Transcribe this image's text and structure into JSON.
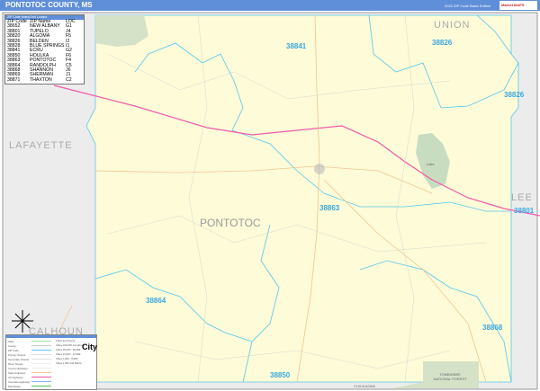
{
  "header": {
    "title": "PONTOTOC COUNTY, MS",
    "edition": "2022 ZIP Code Basic Edition",
    "logo_text": "Market MAPS"
  },
  "zip_table": {
    "title": "ZIP Code Index/Grid Locator",
    "columns": [
      "ZIP Code",
      "ZIP Name",
      "LOC"
    ],
    "rows": [
      [
        "38652",
        "NEW ALBANY",
        "G1"
      ],
      [
        "38801",
        "TUPELO",
        "J4"
      ],
      [
        "38820",
        "ALGOMA",
        "F5"
      ],
      [
        "38826",
        "BELDEN",
        "I2"
      ],
      [
        "38828",
        "BLUE SPRINGS",
        "I1"
      ],
      [
        "38841",
        "ECRU",
        "G2"
      ],
      [
        "38850",
        "HOULKA",
        "F6"
      ],
      [
        "38863",
        "PONTOTOC",
        "F4"
      ],
      [
        "38864",
        "RANDOLPH",
        "C5"
      ],
      [
        "38868",
        "SHANNON",
        "J6"
      ],
      [
        "38869",
        "SHERMAN",
        "J1"
      ],
      [
        "38871",
        "THAXTON",
        "C2"
      ]
    ]
  },
  "map": {
    "counties": {
      "union": "UNION",
      "lafayette": "LAFAYETTE",
      "lee": "LEE",
      "calhoun": "CALHOUN",
      "chickasaw": "CHICKASAW",
      "pontotoc": "PONTOTOC"
    },
    "zip_labels": {
      "z38841": "38841",
      "z38826a": "38826",
      "z38826b": "38826",
      "z38801": "38801",
      "z38863": "38863",
      "z38864": "38864",
      "z38850": "38850",
      "z38868": "38868"
    },
    "park_label": "TOMBIGBEE NATIONAL FOREST",
    "lake_label": "Lake"
  },
  "legend": {
    "title": "Legend",
    "items": [
      "State",
      "County",
      "ZIP Code",
      "Primary Streets",
      "Secondary Streets",
      "Minor Streets",
      "County Highways",
      "State Highways",
      "US Highways",
      "Interstate Highways",
      "Rail Roads"
    ],
    "cities_title": "Cities and Towns",
    "cities": [
      "Cities 100,000 and above",
      "Cities 25,000 - 99,999",
      "Cities 10,000 - 24,999",
      "Cities 1,000 - 9,999",
      "Cities 1,000 and Below"
    ],
    "city_sample": "City"
  },
  "colors": {
    "header": "#5f8fd8",
    "county_fill": "#fdfbd8",
    "outside": "#ececec",
    "zip_line": "#55c8ee",
    "us_highway": "#ef5aa8",
    "forest": "#d6e2c8"
  }
}
